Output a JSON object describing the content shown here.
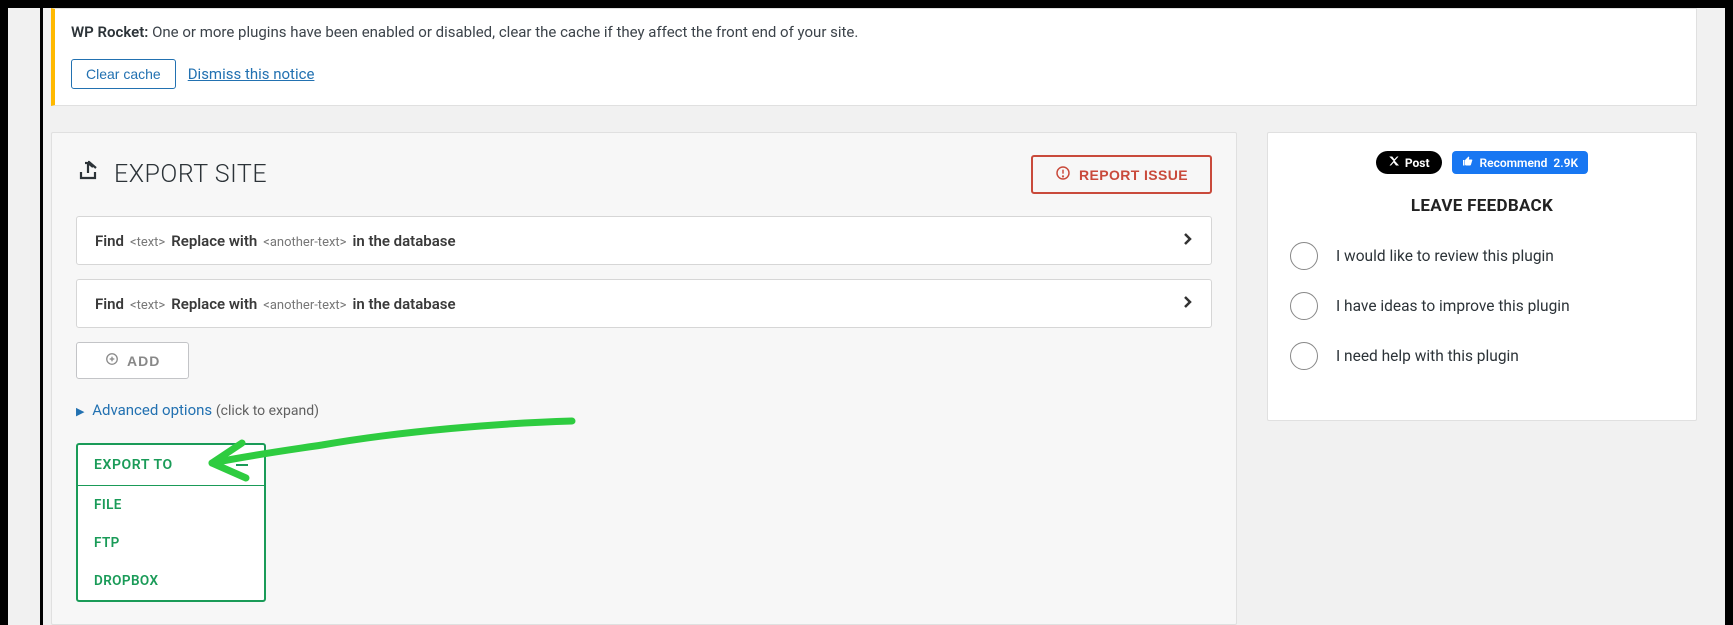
{
  "notice": {
    "prefix": "WP Rocket:",
    "message": "One or more plugins have been enabled or disabled, clear the cache if they affect the front end of your site.",
    "clear_label": "Clear cache",
    "dismiss_label": "Dismiss this notice"
  },
  "panel": {
    "title": "EXPORT SITE",
    "report_label": "REPORT ISSUE"
  },
  "find_replace_row": {
    "find": "Find",
    "text_tag": "<text>",
    "replace": "Replace with",
    "another_tag": "<another-text>",
    "suffix": "in the database"
  },
  "add_label": "ADD",
  "advanced": {
    "label": "Advanced options",
    "hint": "(click to expand)"
  },
  "export": {
    "head": "EXPORT TO",
    "items": [
      "FILE",
      "FTP",
      "DROPBOX"
    ]
  },
  "social": {
    "x_post": "Post",
    "fb_recommend": "Recommend",
    "fb_count": "2.9K"
  },
  "feedback": {
    "title": "LEAVE FEEDBACK",
    "options": [
      "I would like to review this plugin",
      "I have ideas to improve this plugin",
      "I need help with this plugin"
    ]
  }
}
